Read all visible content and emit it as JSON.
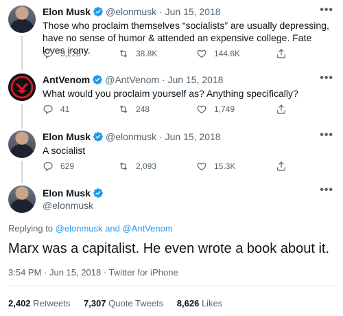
{
  "tweets": [
    {
      "name": "Elon Musk",
      "handle": "@elonmusk",
      "dot": "·",
      "date": "Jun 15, 2018",
      "text": "Those who proclaim themselves “socialists” are usually depressing, have no sense of humor & attended an expensive college. Fate loves irony.",
      "replies": "5,228",
      "retweets": "38.8K",
      "likes": "144.6K"
    },
    {
      "name": "AntVenom",
      "handle": "@AntVenom",
      "dot": "·",
      "date": "Jun 15, 2018",
      "text": "What would you proclaim yourself as? Anything specifically?",
      "replies": "41",
      "retweets": "248",
      "likes": "1,749"
    },
    {
      "name": "Elon Musk",
      "handle": "@elonmusk",
      "dot": "·",
      "date": "Jun 15, 2018",
      "text": "A socialist",
      "replies": "629",
      "retweets": "2,093",
      "likes": "15.3K"
    }
  ],
  "main": {
    "name": "Elon Musk",
    "handle": "@elonmusk",
    "replying_prefix": "Replying to",
    "replying_user1": "@elonmusk",
    "replying_and": "and",
    "replying_user2": "@AntVenom",
    "text": "Marx was a capitalist. He even wrote a book about it.",
    "time": "3:54 PM",
    "date": "Jun 15, 2018",
    "client": "Twitter for iPhone",
    "sep": "·",
    "retweets_count": "2,402",
    "retweets_label": "Retweets",
    "quotes_count": "7,307",
    "quotes_label": "Quote Tweets",
    "likes_count": "8,626",
    "likes_label": "Likes"
  },
  "more_label": "•••",
  "colors": {
    "verified": "#1d9bf0",
    "text_secondary": "#536471",
    "link": "#1d9bf0"
  },
  "icons": [
    "reply-icon",
    "retweet-icon",
    "like-icon",
    "share-icon",
    "verified-badge-icon",
    "more-icon"
  ]
}
